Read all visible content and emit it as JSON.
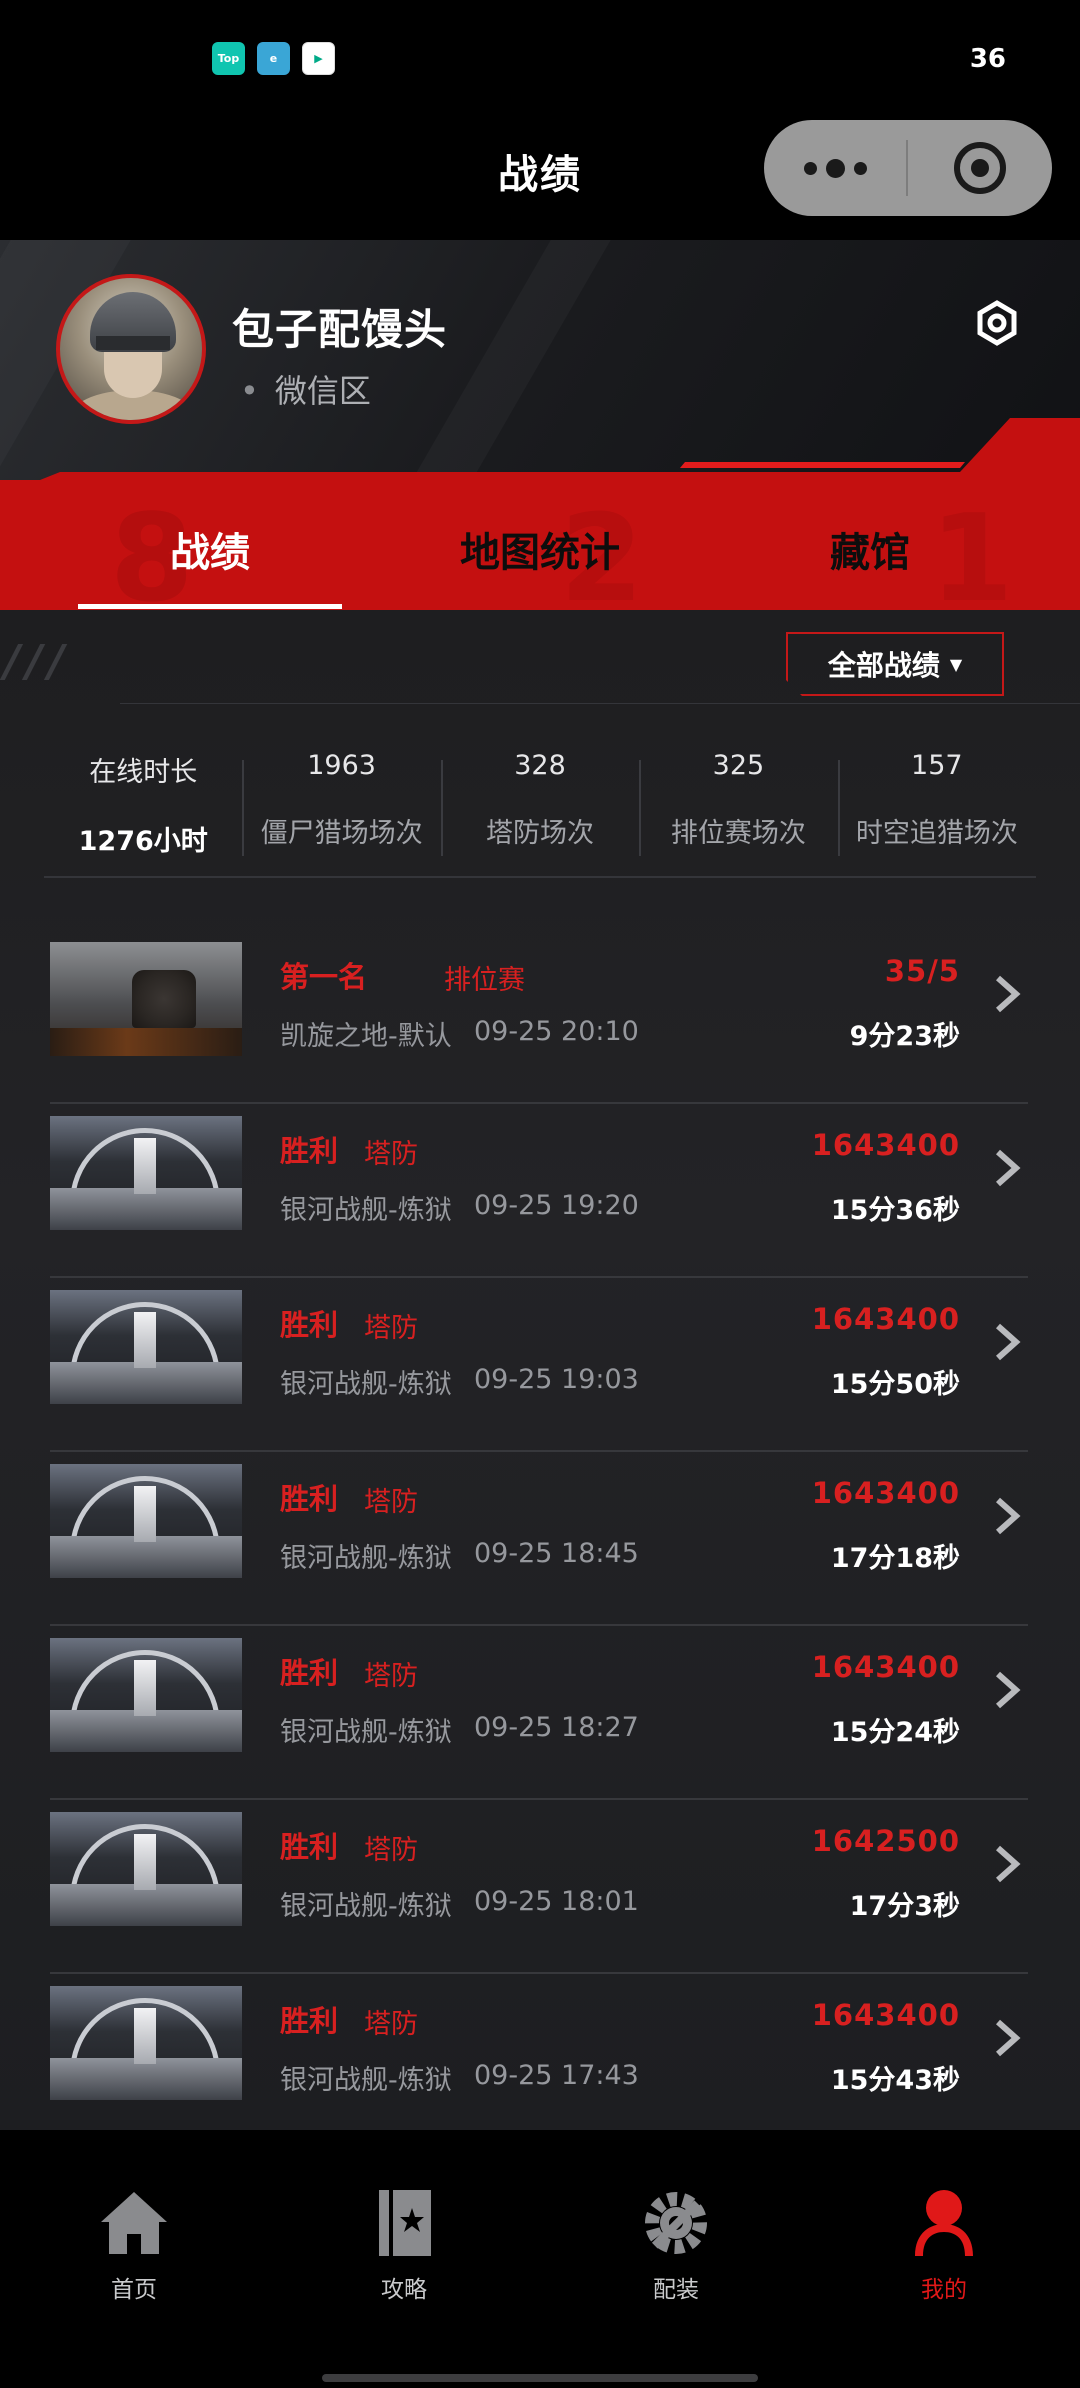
{
  "status_bar": {
    "icons": [
      "Top",
      "e",
      "play"
    ],
    "number": "36"
  },
  "header": {
    "title": "战绩",
    "more_icon": "more-dots-icon",
    "close_icon": "target-close-icon"
  },
  "profile": {
    "name": "包子配馒头",
    "region": "微信区"
  },
  "tabs": [
    {
      "label": "战绩",
      "active": true
    },
    {
      "label": "地图统计",
      "active": false
    },
    {
      "label": "藏馆",
      "active": false
    }
  ],
  "filter": {
    "label": "全部战绩"
  },
  "stats": [
    {
      "top": "在线时长",
      "bottom": "1276小时"
    },
    {
      "top": "1963",
      "bottom": "僵尸猎场场次"
    },
    {
      "top": "328",
      "bottom": "塔防场次"
    },
    {
      "top": "325",
      "bottom": "排位赛场次"
    },
    {
      "top": "157",
      "bottom": "时空追猎场次"
    }
  ],
  "records": [
    {
      "result": "第一名",
      "mode": "排位赛",
      "map": "凯旋之地-默认",
      "time": "09-25 20:10",
      "score": "35/5",
      "duration": "9分23秒",
      "thumb": "mech"
    },
    {
      "result": "胜利",
      "mode": "塔防",
      "map": "银河战舰-炼狱",
      "time": "09-25 19:20",
      "score": "1643400",
      "duration": "15分36秒",
      "thumb": "ship"
    },
    {
      "result": "胜利",
      "mode": "塔防",
      "map": "银河战舰-炼狱",
      "time": "09-25 19:03",
      "score": "1643400",
      "duration": "15分50秒",
      "thumb": "ship"
    },
    {
      "result": "胜利",
      "mode": "塔防",
      "map": "银河战舰-炼狱",
      "time": "09-25 18:45",
      "score": "1643400",
      "duration": "17分18秒",
      "thumb": "ship"
    },
    {
      "result": "胜利",
      "mode": "塔防",
      "map": "银河战舰-炼狱",
      "time": "09-25 18:27",
      "score": "1643400",
      "duration": "15分24秒",
      "thumb": "ship"
    },
    {
      "result": "胜利",
      "mode": "塔防",
      "map": "银河战舰-炼狱",
      "time": "09-25 18:01",
      "score": "1642500",
      "duration": "17分3秒",
      "thumb": "ship"
    },
    {
      "result": "胜利",
      "mode": "塔防",
      "map": "银河战舰-炼狱",
      "time": "09-25 17:43",
      "score": "1643400",
      "duration": "15分43秒",
      "thumb": "ship"
    }
  ],
  "bottom_nav": [
    {
      "label": "首页",
      "icon": "home-icon",
      "active": false
    },
    {
      "label": "攻略",
      "icon": "guide-book-icon",
      "active": false
    },
    {
      "label": "配装",
      "icon": "gear-wrench-icon",
      "active": false
    },
    {
      "label": "我的",
      "icon": "user-icon",
      "active": true
    }
  ],
  "colors": {
    "accent_red": "#d82020",
    "band_red": "#c41010",
    "background": "#1e1e20"
  }
}
